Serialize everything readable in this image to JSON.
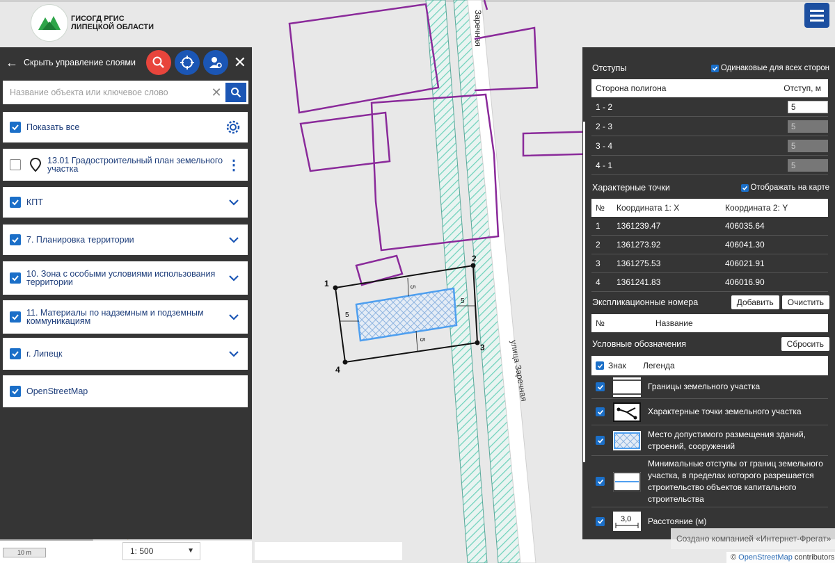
{
  "logo": {
    "line1": "ГИСОГД РГИС",
    "line2": "ЛИПЕЦКОЙ ОБЛАСТИ"
  },
  "left_panel": {
    "header_title": "Скрыть управление слоями",
    "search_placeholder": "Название объекта или ключевое слово",
    "show_all_label": "Показать все",
    "layers": [
      {
        "label": "13.01 Градостроительный план земельного участка",
        "checked": false
      },
      {
        "label": "КПТ",
        "checked": true
      },
      {
        "label": "7. Планировка территории",
        "checked": true
      },
      {
        "label": "10. Зона с особыми условиями использования территории",
        "checked": true
      },
      {
        "label": "11. Материалы по надземным и подземным коммуникациям",
        "checked": true
      },
      {
        "label": "г. Липецк",
        "checked": true
      },
      {
        "label": "OpenStreetMap",
        "checked": true
      }
    ]
  },
  "map": {
    "street_top": "Заречная",
    "street_mid": "улица Заречная",
    "points": [
      "1",
      "2",
      "3",
      "4"
    ],
    "offset_labels": [
      "5",
      "5",
      "5",
      "5"
    ],
    "scale_ruler": "10 m",
    "scale": "1: 500",
    "attribution_symbol": "©",
    "attribution_link": "OpenStreetMap",
    "attribution_suffix": "contributors.",
    "created_by": "Создано компанией «Интернет-Фрегат»"
  },
  "right_panel": {
    "offsets_title": "Отступы",
    "same_all_label": "Одинаковые для всех сторон",
    "offsets_col1": "Сторона полигона",
    "offsets_col2": "Отступ, м",
    "offsets": [
      {
        "side": "1 - 2",
        "value": "5"
      },
      {
        "side": "2 - 3",
        "value": "5"
      },
      {
        "side": "3 - 4",
        "value": "5"
      },
      {
        "side": "4 - 1",
        "value": "5"
      }
    ],
    "points_title": "Характерные точки",
    "show_on_map_label": "Отображать на карте",
    "points_cols": [
      "№",
      "Координата 1: X",
      "Координата 2: Y"
    ],
    "points": [
      {
        "n": "1",
        "x": "1361239.47",
        "y": "406035.64"
      },
      {
        "n": "2",
        "x": "1361273.92",
        "y": "406041.30"
      },
      {
        "n": "3",
        "x": "1361275.53",
        "y": "406021.91"
      },
      {
        "n": "4",
        "x": "1361241.83",
        "y": "406016.90"
      }
    ],
    "expl_title": "Экспликационные номера",
    "add_label": "Добавить",
    "clear_label": "Очистить",
    "expl_cols": [
      "№",
      "Название"
    ],
    "legend_title": "Условные обозначения",
    "reset_label": "Сбросить",
    "legend_cols": [
      "Знак",
      "Легенда"
    ],
    "legend": [
      "Границы земельного участка",
      "Характерные точки земельного участка",
      "Место допустимого размещения зданий, строений, сооружений",
      "Минимальные отступы от границ земельного участка, в пределах которого разрешается строительство объектов капитального строительства",
      "Расстояние (м)"
    ],
    "distance_icon_value": "3,0"
  },
  "colors": {
    "accent_blue": "#1b56b5",
    "red": "#e8453c",
    "panel_bg": "#353535",
    "parcel_purple": "#8a2a9a",
    "hatch_green": "#5dc8b0"
  }
}
